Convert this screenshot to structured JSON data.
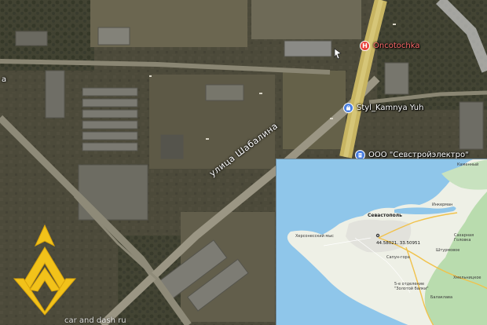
{
  "labels": {
    "poi_oncotochka": "Oncotochka",
    "poi_styl": "Styl_Kamnya Yuh",
    "poi_sevstroy": "ООО \"Севстройэлектро\"",
    "street": "улица Шабалина",
    "edge_left": "а",
    "watermark": "car and dash ru"
  },
  "inset_labels": {
    "city": "Севастополь",
    "coords": "44.58021, 33.50951",
    "place_top_right": "Каменный",
    "place_inkerman": "Инкерман",
    "place_sakharnaya": "Сахарная Головка",
    "place_shturmovoe": "Штурмовое",
    "place_khmelnitskoe": "Хмельницкое",
    "place_balaklava": "Балаклава",
    "place_zolotaya": "5-е отделение \"Золотой балки\"",
    "place_left": "Херсонесский мыс",
    "place_mid": "Сапун-гора"
  },
  "colors": {
    "poi_red": "#e8453c",
    "poi_blue": "#4a7fe0",
    "logo_yellow": "#f2c21a",
    "sea": "#8fc6ea",
    "land": "#eef0e6",
    "green": "#b9dcae"
  },
  "icons": {
    "hospital": "H",
    "shop": "bag",
    "office": "building"
  }
}
